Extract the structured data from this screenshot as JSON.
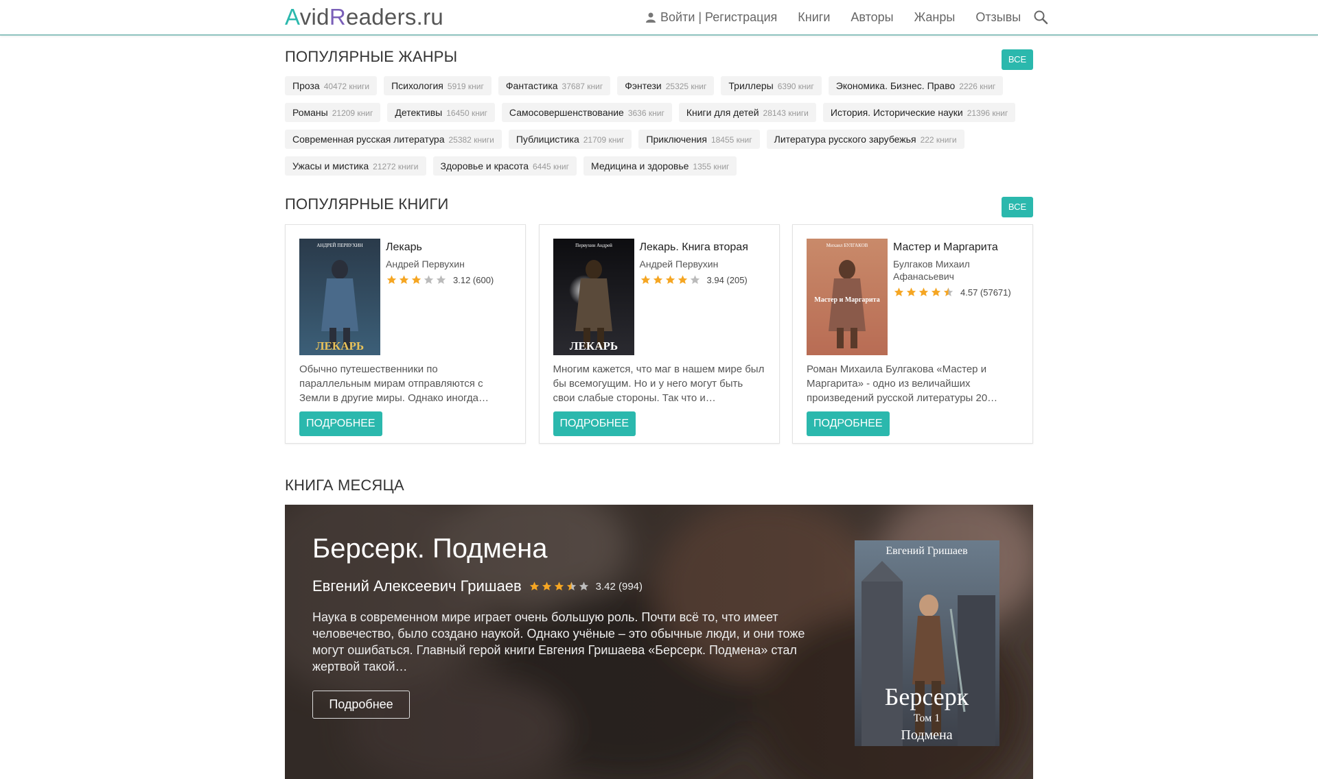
{
  "header": {
    "logo": {
      "a": "A",
      "vid": "vid",
      "r": "R",
      "rest": "eaders.ru"
    },
    "login": "Войти | Регистрация",
    "nav": [
      "Книги",
      "Авторы",
      "Жанры",
      "Отзывы"
    ]
  },
  "genres_section": {
    "title": "Популярные жанры",
    "all": "Все",
    "items": [
      {
        "name": "Проза",
        "count": "40472 книги"
      },
      {
        "name": "Психология",
        "count": "5919 книг"
      },
      {
        "name": "Фантастика",
        "count": "37687 книг"
      },
      {
        "name": "Фэнтези",
        "count": "25325 книг"
      },
      {
        "name": "Триллеры",
        "count": "6390 книг"
      },
      {
        "name": "Экономика. Бизнес. Право",
        "count": "2226 книг"
      },
      {
        "name": "Романы",
        "count": "21209 книг"
      },
      {
        "name": "Детективы",
        "count": "16450 книг"
      },
      {
        "name": "Самосовершенствование",
        "count": "3636 книг"
      },
      {
        "name": "Книги для детей",
        "count": "28143 книги"
      },
      {
        "name": "История. Исторические науки",
        "count": "21396 книг"
      },
      {
        "name": "Современная русская литература",
        "count": "25382 книги"
      },
      {
        "name": "Публицистика",
        "count": "21709 книг"
      },
      {
        "name": "Приключения",
        "count": "18455 книг"
      },
      {
        "name": "Литература русского зарубежья",
        "count": "222 книги"
      },
      {
        "name": "Ужасы и мистика",
        "count": "21272 книги"
      },
      {
        "name": "Здоровье и красота",
        "count": "6445 книг"
      },
      {
        "name": "Медицина и здоровье",
        "count": "1355 книг"
      }
    ]
  },
  "books_section": {
    "title": "Популярные книги",
    "all": "Все",
    "more_label": "Подробнее",
    "books": [
      {
        "title": "Лекарь",
        "author": "Андрей Первухин",
        "rating": "3.12 (600)",
        "stars": 3.12,
        "desc": "Обычно путешественники по параллельным мирам отправляются с Земли в другие миры. Однако иногда…",
        "cover": {
          "top_text": "АНДРЕЙ ПЕРВУХИН",
          "bottom_text": "ЛЕКАРЬ"
        }
      },
      {
        "title": "Лекарь. Книга вторая",
        "author": "Андрей Первухин",
        "rating": "3.94 (205)",
        "stars": 3.94,
        "desc": "Многим кажется, что маг в нашем мире был бы всемогущим. Но и у него могут быть свои слабые стороны. Так что и…",
        "cover": {
          "top_text": "Первухин Андрей",
          "bottom_text": "ЛЕКАРЬ"
        }
      },
      {
        "title": "Мастер и Маргарита",
        "author": "Булгаков Михаил Афанасьевич",
        "rating": "4.57 (57671)",
        "stars": 4.57,
        "desc": "Роман Михаила Булгакова «Мастер и Маргарита» - одно из величайших произведений русской литературы 20…",
        "cover": {
          "top_text": "Михаил БУЛГАКОВ",
          "bottom_text": "Мастер и Маргарита"
        }
      }
    ]
  },
  "month_section": {
    "title": "Книга месяца",
    "book_title": "Берсерк. Подмена",
    "author": "Евгений Алексеевич Гришаев",
    "rating": "3.42 (994)",
    "stars": 3.42,
    "desc": "Наука в современном мире играет очень большую роль. Почти всё то, что имеет человечество, было создано наукой. Однако учёные – это обычные люди, и они тоже могут ошибаться. Главный герой книги Евгения Гришаева «Берсерк. Подмена» стал жертвой такой…",
    "button": "Подробнее",
    "cover": {
      "author": "Евгений Гришаев",
      "title1": "Берсерк",
      "title2": "Том 1",
      "title3": "Подмена"
    }
  },
  "colors": {
    "accent": "#2bb8ad",
    "star": "#f5a623",
    "star_empty": "#bbbbbb"
  }
}
